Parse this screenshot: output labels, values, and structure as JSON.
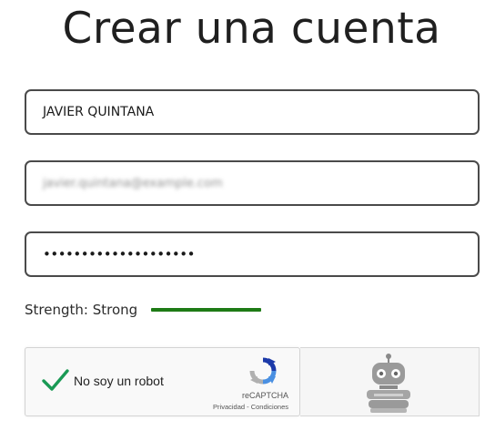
{
  "page": {
    "title": "Crear una cuenta"
  },
  "form": {
    "name_value": "JAVIER QUINTANA",
    "email_value": "javier.quintana@example.com",
    "password_value": "••••••••••••••••••••"
  },
  "strength": {
    "label": "Strength: Strong",
    "level": 1.0,
    "color": "#1e7b16"
  },
  "captcha": {
    "label": "No soy un robot",
    "brand": "reCAPTCHA",
    "links": "Privacidad - Condiciones",
    "checked": true,
    "check_color": "#1a9a55"
  },
  "icons": {
    "check": "checkmark-icon",
    "recaptcha": "recaptcha-logo-icon",
    "robot": "robot-icon"
  }
}
